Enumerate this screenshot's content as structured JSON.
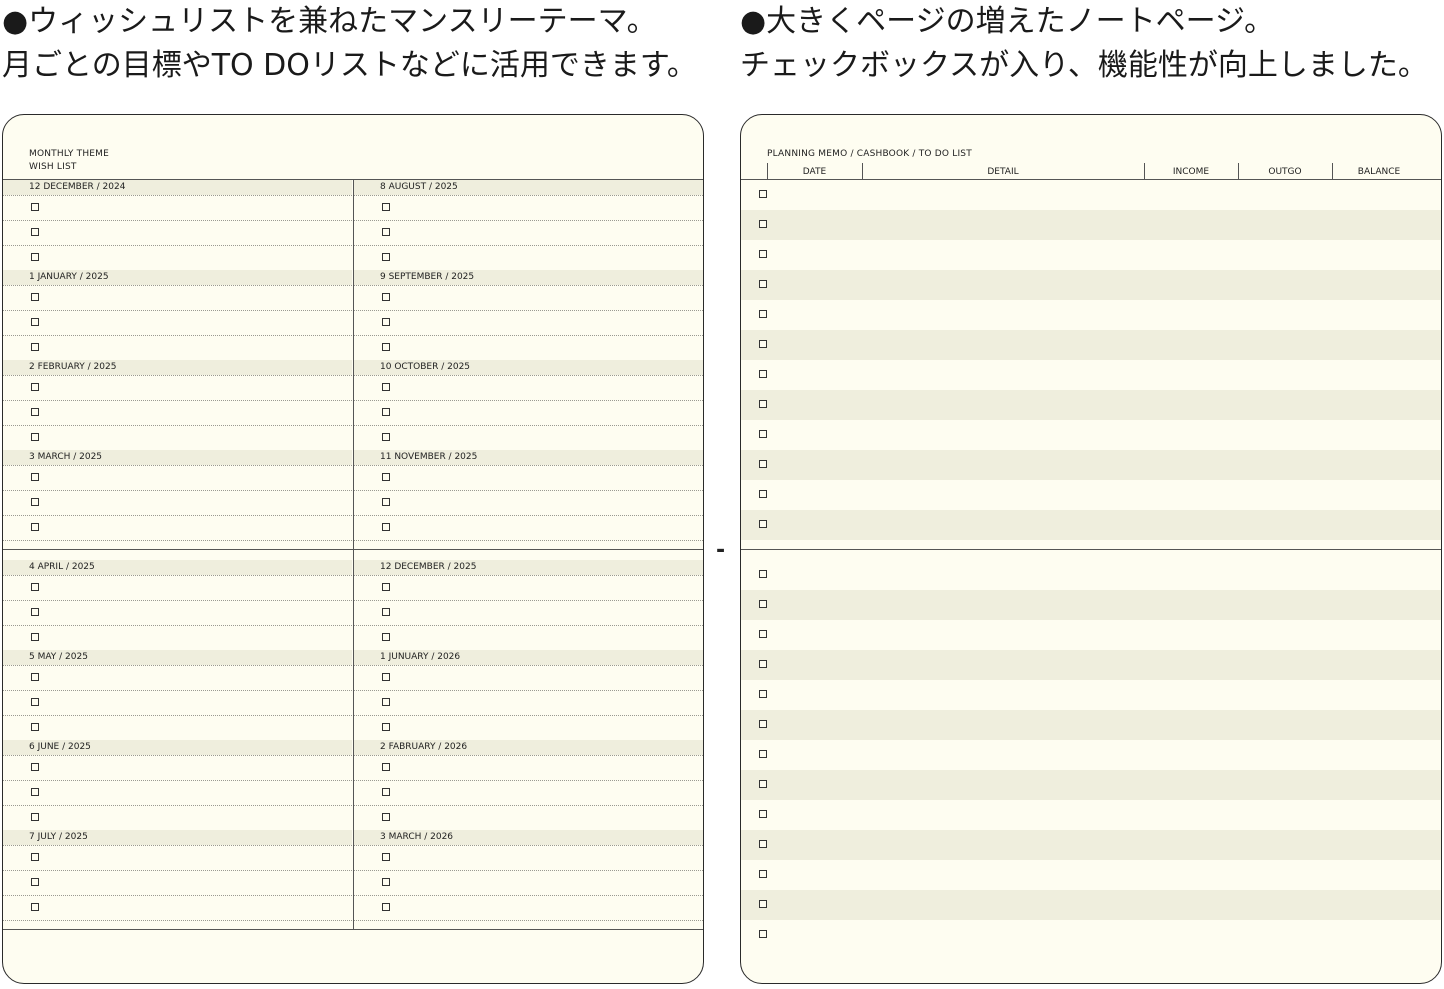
{
  "captions": {
    "left": [
      "●ウィッシュリストを兼ねたマンスリーテーマ。",
      "月ごとの目標やTO DOリストなどに活用できます。"
    ],
    "right": [
      "●大きくページの増えたノートページ。",
      "チェックボックスが入り、機能性が向上しました。"
    ]
  },
  "left_page": {
    "header": [
      "MONTHLY THEME",
      "WISH LIST"
    ],
    "blocks": [
      {
        "left": [
          "12 DECEMBER / 2024",
          "1 JANUARY / 2025",
          "2 FEBRUARY / 2025",
          "3 MARCH / 2025"
        ],
        "right": [
          "8 AUGUST / 2025",
          "9 SEPTEMBER / 2025",
          "10 OCTOBER / 2025",
          "11 NOVEMBER / 2025"
        ]
      },
      {
        "left": [
          "4 APRIL / 2025",
          "5 MAY / 2025",
          "6 JUNE / 2025",
          "7 JULY / 2025"
        ],
        "right": [
          "12 DECEMBER / 2025",
          "1 JUNUARY / 2026",
          "2 FABRUARY / 2026",
          "3 MARCH / 2026"
        ]
      }
    ],
    "checkboxes_per_month": 3
  },
  "right_page": {
    "title": "PLANNING MEMO / CASHBOOK / TO DO LIST",
    "columns": [
      "DATE",
      "DETAIL",
      "INCOME",
      "OUTGO",
      "BALANCE"
    ],
    "top_rows": 12,
    "bottom_rows": 13
  },
  "separator": "-"
}
